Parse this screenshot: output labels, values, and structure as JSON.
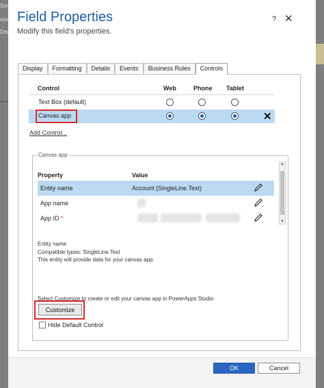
{
  "background": {
    "fragments": [
      "Security Roles",
      "epe",
      "Dep"
    ]
  },
  "dialog": {
    "title": "Field Properties",
    "subtitle": "Modify this field's properties.",
    "help_icon": "?",
    "close_icon": "✕"
  },
  "tabs": [
    "Display",
    "Formatting",
    "Details",
    "Events",
    "Business Rules",
    "Controls"
  ],
  "active_tab": "Controls",
  "controls_table": {
    "headers": {
      "control": "Control",
      "web": "Web",
      "phone": "Phone",
      "tablet": "Tablet"
    },
    "rows": [
      {
        "label": "Text Box (default)",
        "web": false,
        "phone": false,
        "tablet": false
      },
      {
        "label": "Canvas app",
        "web": true,
        "phone": true,
        "tablet": true
      }
    ],
    "add_control": "Add Control..."
  },
  "canvas_group": {
    "title": "Canvas app",
    "headers": {
      "property": "Property",
      "value": "Value"
    },
    "rows": [
      {
        "name": "Entity name",
        "value": "Account (SingleLine.Text)",
        "required": false
      },
      {
        "name": "App name",
        "value": "",
        "required": false
      },
      {
        "name": "App ID",
        "value": "",
        "required": true
      }
    ],
    "required_marker": "*",
    "description": {
      "line1": "Entity name",
      "line2": "Compatible types: SingleLine.Text",
      "line3": "This entity will provide data for your canvas app."
    },
    "customize_hint": "Select Customize to create or edit your canvas app in PowerApps Studio",
    "customize_button": "Customize",
    "hide_default": {
      "label": "Hide Default Control",
      "checked": false
    }
  },
  "footer": {
    "ok": "OK",
    "cancel": "Cancel"
  },
  "colors": {
    "title": "#1f5da0",
    "selected_row": "#bcd9f2",
    "highlight_border": "#d42a2a",
    "ok_button": "#2b66c0"
  }
}
